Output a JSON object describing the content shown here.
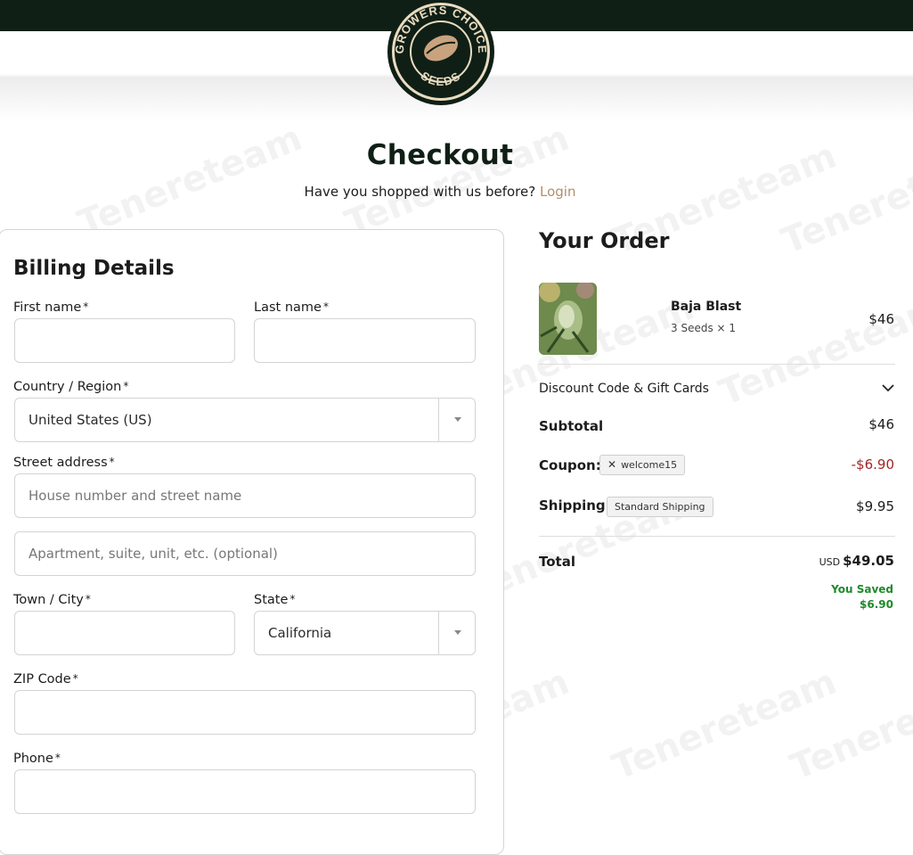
{
  "brand": {
    "logo_text_top": "GROWERS CHOICE",
    "logo_text_bottom": "SEEDS"
  },
  "watermark": "Tenereteam",
  "page": {
    "title": "Checkout",
    "returning_prompt": "Have you shopped with us before?",
    "login_link": "Login"
  },
  "billing": {
    "title": "Billing Details",
    "first_name": {
      "label": "First name",
      "value": ""
    },
    "last_name": {
      "label": "Last name",
      "value": ""
    },
    "country": {
      "label": "Country / Region",
      "value": "United States (US)"
    },
    "street": {
      "label": "Street address",
      "placeholder_1": "House number and street name",
      "placeholder_2": "Apartment, suite, unit, etc. (optional)"
    },
    "city": {
      "label": "Town / City",
      "value": ""
    },
    "state": {
      "label": "State",
      "value": "California"
    },
    "zip": {
      "label": "ZIP Code",
      "value": ""
    },
    "phone": {
      "label": "Phone",
      "value": ""
    },
    "required_mark": "*"
  },
  "order": {
    "title": "Your Order",
    "item": {
      "name": "Baja Blast",
      "variant": "3 Seeds",
      "qty": "× 1",
      "price": "$46"
    },
    "discount_label": "Discount Code & Gift Cards",
    "subtotal": {
      "label": "Subtotal",
      "value": "$46"
    },
    "coupon": {
      "label": "Coupon:",
      "code": "welcome15",
      "value": "-$6.90"
    },
    "shipping": {
      "label": "Shipping:",
      "method": "Standard Shipping",
      "value": "$9.95"
    },
    "total": {
      "label": "Total",
      "currency": "USD",
      "value": "$49.05"
    },
    "saved": {
      "label": "You Saved",
      "value": "$6.90"
    }
  },
  "colors": {
    "dark_green": "#0f1f16",
    "link_tan": "#b0906a",
    "discount_red": "#a12626",
    "saved_green": "#1f8a2a"
  }
}
